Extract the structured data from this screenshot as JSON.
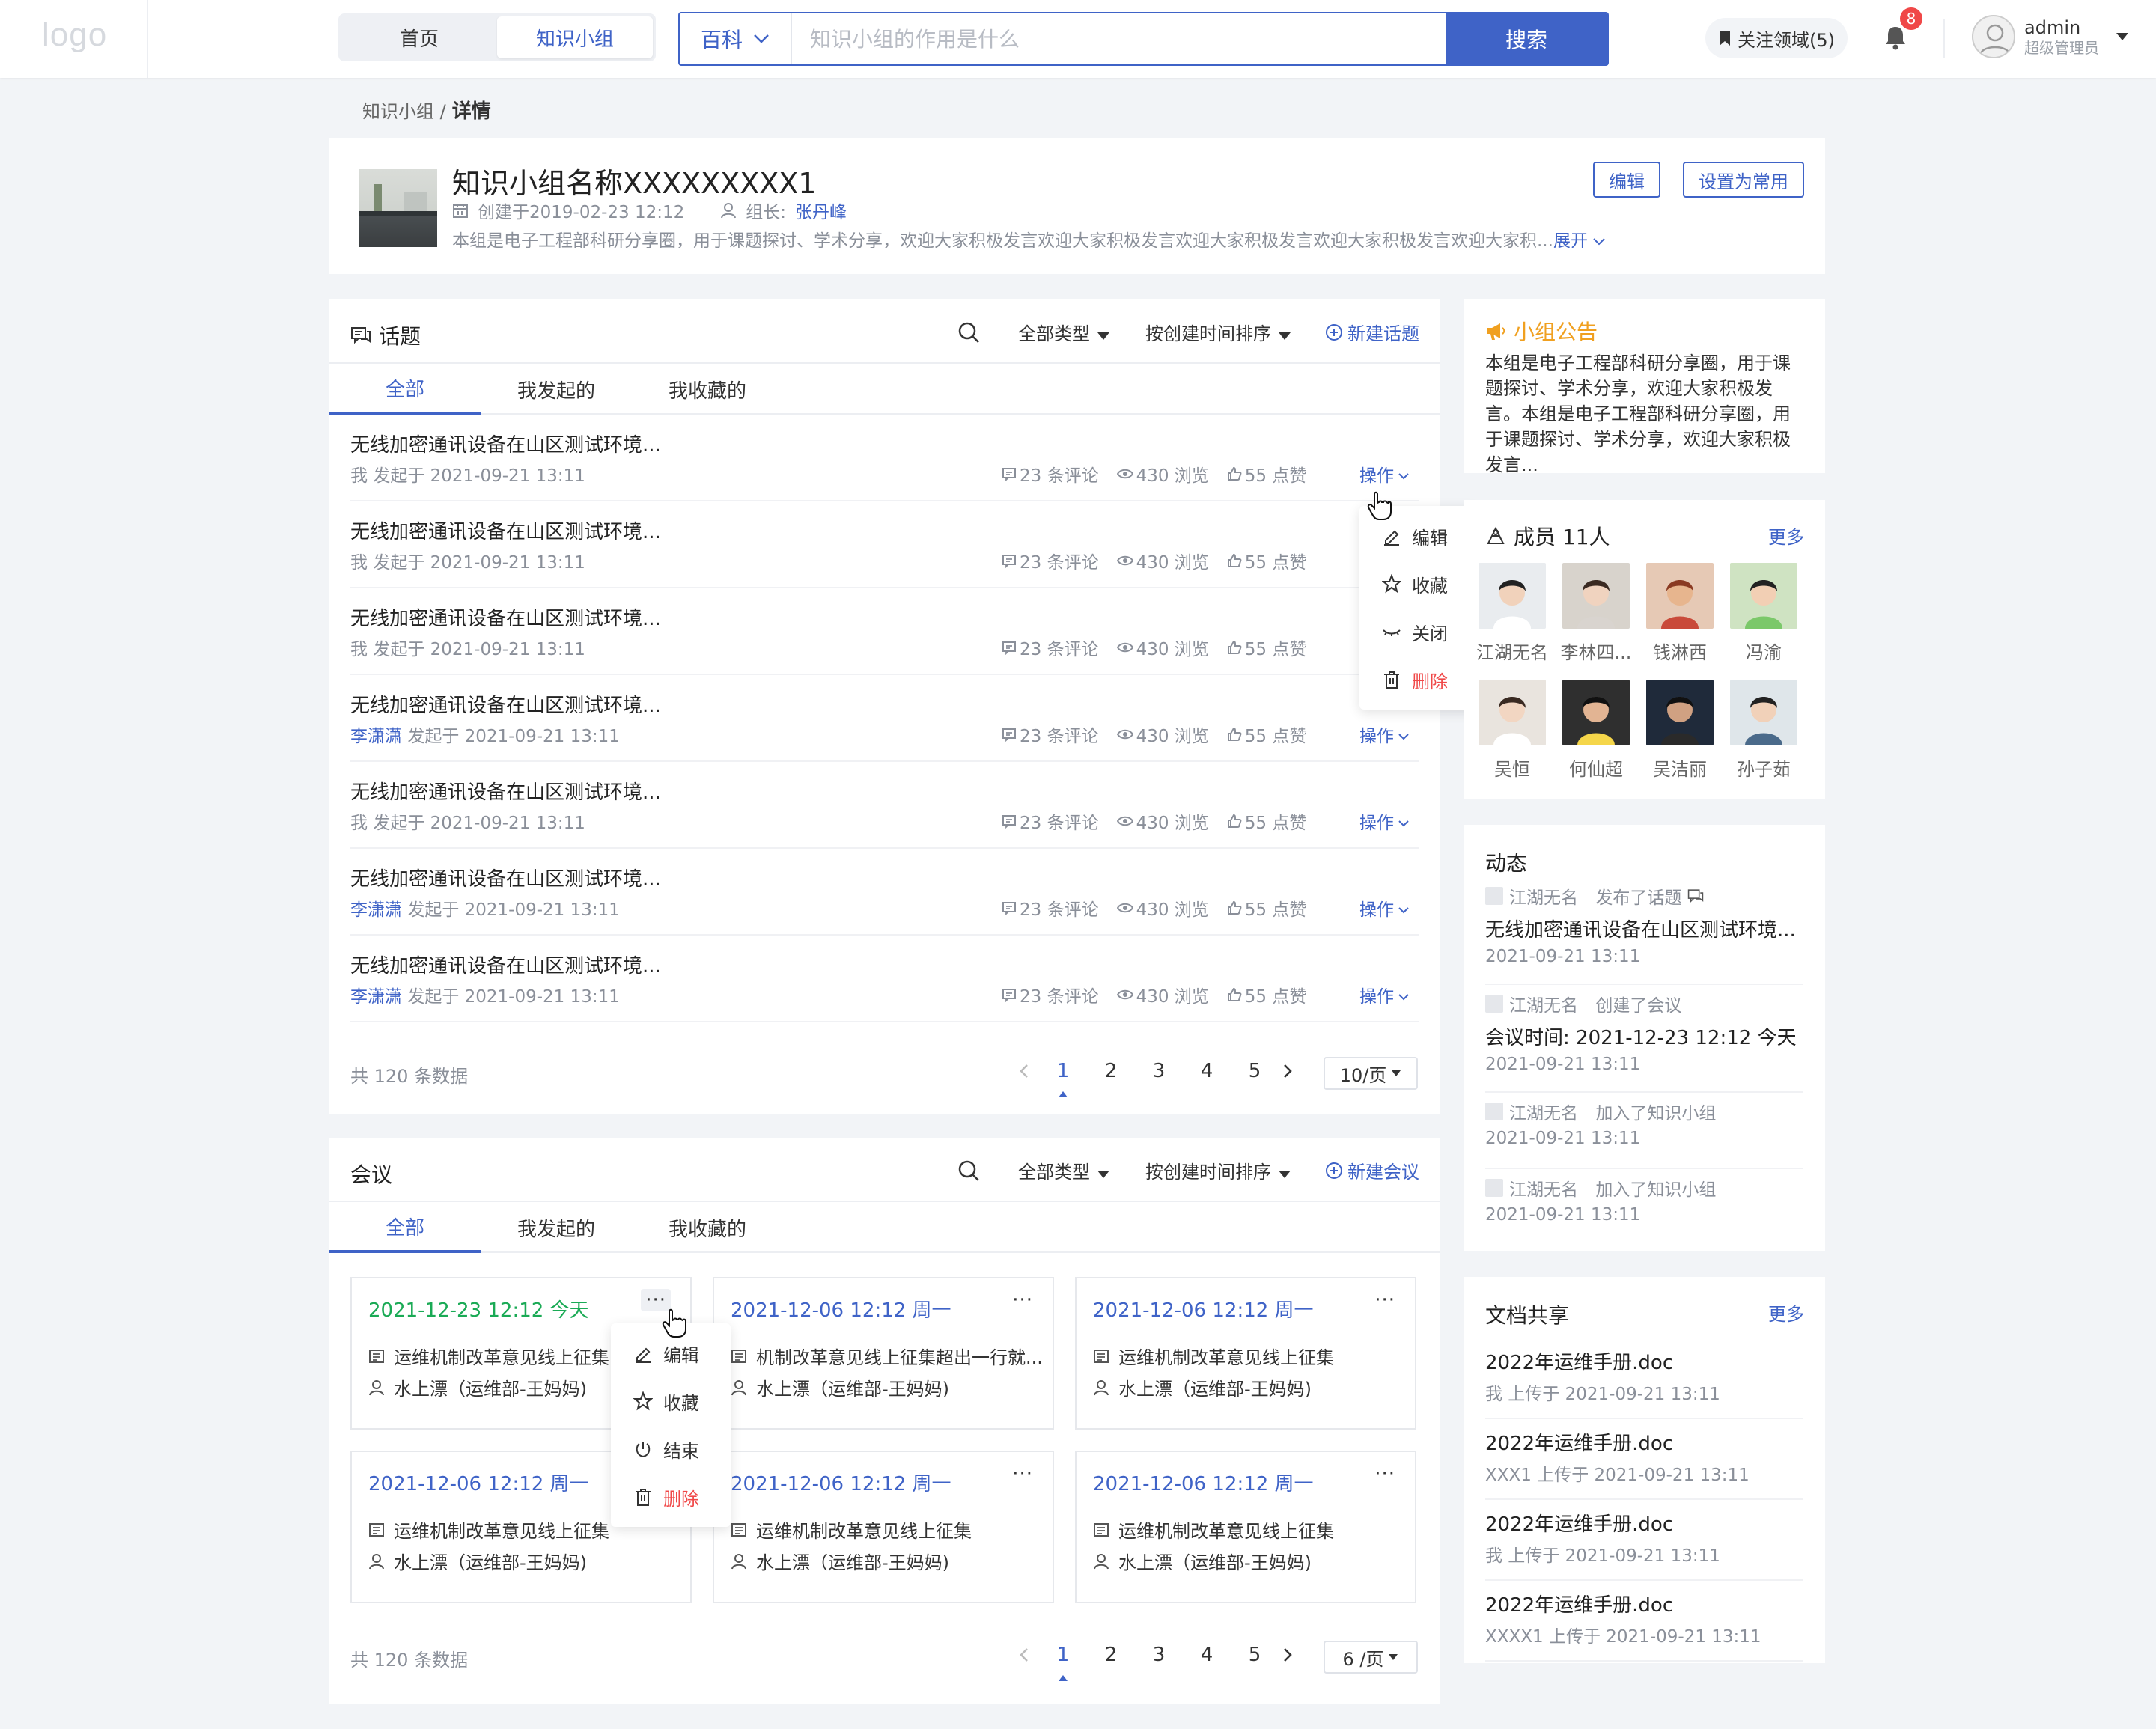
{
  "topbar": {
    "logo": "logo",
    "nav": [
      "首页",
      "知识小组"
    ],
    "search_category": "百科",
    "search_placeholder": "知识小组的作用是什么",
    "search_button": "搜索",
    "follow": "关注领域(5)",
    "notification_count": "8",
    "user_name": "admin",
    "user_role": "超级管理员"
  },
  "breadcrumb": {
    "parent": "知识小组 /",
    "current": "详情"
  },
  "group": {
    "name": "知识小组名称XXXXXXXXX1",
    "created": "创建于2019-02-23 12:12",
    "leader_label": "组长:",
    "leader": "张丹峰",
    "desc": "本组是电子工程部科研分享圈，用于课题探讨、学术分享，欢迎大家积极发言欢迎大家积极发言欢迎大家积极发言欢迎大家积极发言欢迎大家积...",
    "expand": "展开",
    "edit_btn": "编辑",
    "set_common_btn": "设置为常用"
  },
  "topics": {
    "title": "话题",
    "filter_type": "全部类型",
    "filter_sort": "按创建时间排序",
    "new_btn": "新建话题",
    "tabs": [
      "全部",
      "我发起的",
      "我收藏的"
    ],
    "rows": [
      {
        "title": "无线加密通讯设备在山区测试环境...",
        "who": "我",
        "time": "发起于 2021-09-21 13:11",
        "comments": "23 条评论",
        "views": "430 浏览",
        "likes": "55 点赞",
        "op": "操作"
      },
      {
        "title": "无线加密通讯设备在山区测试环境...",
        "who": "我",
        "time": "发起于 2021-09-21 13:11",
        "comments": "23 条评论",
        "views": "430 浏览",
        "likes": "55 点赞",
        "op": ""
      },
      {
        "title": "无线加密通讯设备在山区测试环境...",
        "who": "我",
        "time": "发起于 2021-09-21 13:11",
        "comments": "23 条评论",
        "views": "430 浏览",
        "likes": "55 点赞",
        "op": ""
      },
      {
        "title": "无线加密通讯设备在山区测试环境...",
        "who": "李潇潇",
        "time": "发起于 2021-09-21 13:11",
        "comments": "23 条评论",
        "views": "430 浏览",
        "likes": "55 点赞",
        "op": "操作"
      },
      {
        "title": "无线加密通讯设备在山区测试环境...",
        "who": "我",
        "time": "发起于 2021-09-21 13:11",
        "comments": "23 条评论",
        "views": "430 浏览",
        "likes": "55 点赞",
        "op": "操作"
      },
      {
        "title": "无线加密通讯设备在山区测试环境...",
        "who": "李潇潇",
        "time": "发起于 2021-09-21 13:11",
        "comments": "23 条评论",
        "views": "430 浏览",
        "likes": "55 点赞",
        "op": "操作"
      },
      {
        "title": "无线加密通讯设备在山区测试环境...",
        "who": "李潇潇",
        "time": "发起于 2021-09-21 13:11",
        "comments": "23 条评论",
        "views": "430 浏览",
        "likes": "55 点赞",
        "op": "操作"
      }
    ],
    "dropdown": [
      "编辑",
      "收藏",
      "关闭",
      "删除"
    ],
    "total": "共 120 条数据",
    "pages": [
      "1",
      "2",
      "3",
      "4",
      "5"
    ],
    "page_size": "10/页"
  },
  "meetings": {
    "title": "会议",
    "filter_type": "全部类型",
    "filter_sort": "按创建时间排序",
    "new_btn": "新建会议",
    "tabs": [
      "全部",
      "我发起的",
      "我收藏的"
    ],
    "cards": [
      {
        "date": "2021-12-23 12:12 今天",
        "subject": "运维机制改革意见线上征集",
        "person": "水上漂（运维部-王妈妈)"
      },
      {
        "date": "2021-12-06 12:12 周一",
        "subject": "机制改革意见线上征集超出一行就...",
        "person": "水上漂（运维部-王妈妈)"
      },
      {
        "date": "2021-12-06 12:12 周一",
        "subject": "运维机制改革意见线上征集",
        "person": "水上漂（运维部-王妈妈)"
      },
      {
        "date": "2021-12-06 12:12 周一",
        "subject": "运维机制改革意见线上征集",
        "person": "水上漂（运维部-王妈妈)"
      },
      {
        "date": "2021-12-06 12:12 周一",
        "subject": "运维机制改革意见线上征集",
        "person": "水上漂（运维部-王妈妈)"
      },
      {
        "date": "2021-12-06 12:12 周一",
        "subject": "运维机制改革意见线上征集",
        "person": "水上漂（运维部-王妈妈)"
      }
    ],
    "more_glyph": "···",
    "dropdown": [
      "编辑",
      "收藏",
      "结束",
      "删除"
    ],
    "total": "共 120 条数据",
    "pages": [
      "1",
      "2",
      "3",
      "4",
      "5"
    ],
    "page_size": "6 /页"
  },
  "notice": {
    "title": "小组公告",
    "text": "本组是电子工程部科研分享圈，用于课题探讨、学术分享，欢迎大家积极发言。本组是电子工程部科研分享圈，用于课题探讨、学术分享，欢迎大家积极发言..."
  },
  "members": {
    "title": "成员 11人",
    "more": "更多",
    "list": [
      "江湖无名",
      "李林四...",
      "钱淋西",
      "冯渝",
      "吴恒",
      "何仙超",
      "吴洁丽",
      "孙子茹"
    ]
  },
  "activity": {
    "title": "动态",
    "items": [
      {
        "user": "江湖无名",
        "action": "发布了话题",
        "content": "无线加密通讯设备在山区测试环境...",
        "time": "2021-09-21 13:11"
      },
      {
        "user": "江湖无名",
        "action": "创建了会议",
        "content": "会议时间:  2021-12-23 12:12 今天",
        "time": "2021-09-21 13:11"
      },
      {
        "user": "江湖无名",
        "action": "加入了知识小组",
        "content": "",
        "time": "2021-09-21 13:11"
      },
      {
        "user": "江湖无名",
        "action": "加入了知识小组",
        "content": "",
        "time": "2021-09-21 13:11"
      }
    ]
  },
  "docs": {
    "title": "文档共享",
    "more": "更多",
    "items": [
      {
        "name": "2022年运维手册.doc",
        "meta": "我 上传于 2021-09-21 13:11"
      },
      {
        "name": "2022年运维手册.doc",
        "meta": "XXX1 上传于 2021-09-21 13:11"
      },
      {
        "name": "2022年运维手册.doc",
        "meta": "我 上传于 2021-09-21 13:11"
      },
      {
        "name": "2022年运维手册.doc",
        "meta": "XXXX1 上传于 2021-09-21 13:11"
      }
    ]
  },
  "colors": {
    "accent": "#3f63c7",
    "danger": "#f04848",
    "today": "#1aaa55",
    "notice": "#f0a020"
  }
}
